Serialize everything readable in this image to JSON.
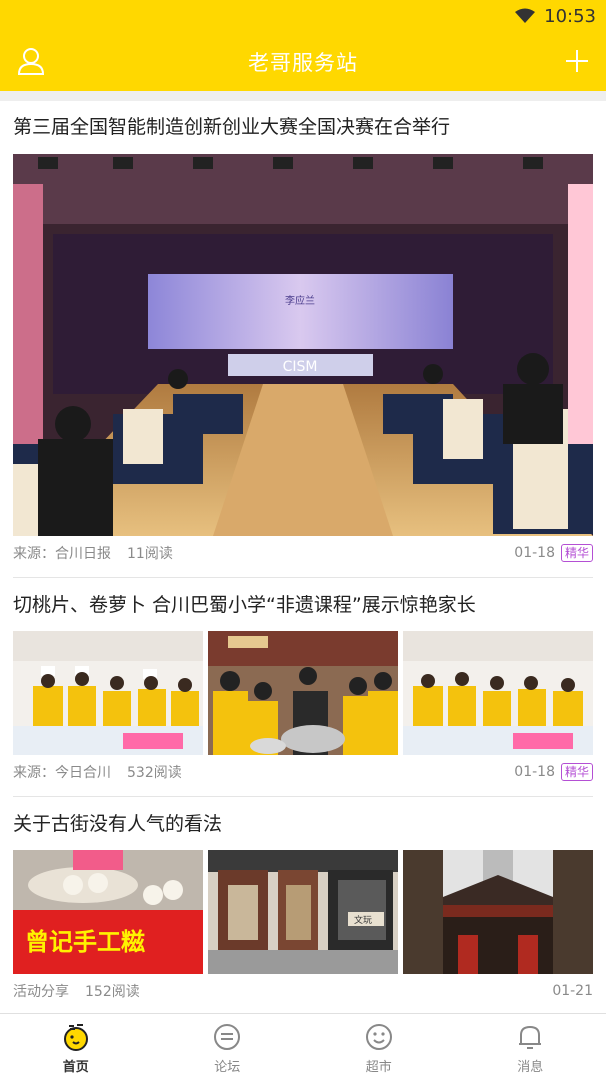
{
  "status_bar": {
    "time": "10:53",
    "wifi_icon": "wifi-icon"
  },
  "app_bar": {
    "title": "老哥服务站",
    "left_icon": "user-icon",
    "right_icon": "plus-icon"
  },
  "articles": [
    {
      "title": "第三届全国智能制造创新创业大赛全国决赛在合举行",
      "source": "来源：合川日报",
      "views": "11阅读",
      "date": "01-18",
      "badge": "精华",
      "images": [
        "conference-hall-photo"
      ],
      "screen_text": {
        "speaker_name": "李应兰",
        "stage_logo": "CISM"
      }
    },
    {
      "title": "切桃片、卷萝卜 合川巴蜀小学“非遗课程”展示惊艳家长",
      "source": "来源：今日合川",
      "views": "532阅读",
      "date": "01-18",
      "badge": "精华",
      "images": [
        "students-cooking-photo-1",
        "students-steamer-photo",
        "students-cooking-photo-2"
      ]
    },
    {
      "title": "关于古街没有人气的看法",
      "source": "活动分享",
      "views": "152阅读",
      "date": "01-21",
      "images": [
        "street-food-stall-photo",
        "shop-front-photo",
        "old-street-gate-photo"
      ],
      "sign_text": {
        "food_stall": "曾记手工糍",
        "shop": "文玩"
      }
    }
  ],
  "tab_bar": {
    "items": [
      {
        "label": "首页",
        "icon": "home-icon",
        "active": true
      },
      {
        "label": "论坛",
        "icon": "forum-icon",
        "active": false
      },
      {
        "label": "超市",
        "icon": "market-icon",
        "active": false
      },
      {
        "label": "消息",
        "icon": "message-icon",
        "active": false
      }
    ]
  },
  "colors": {
    "accent": "#ffd800",
    "badge": "#b44fd4",
    "meta_text": "#8a8a8a"
  }
}
